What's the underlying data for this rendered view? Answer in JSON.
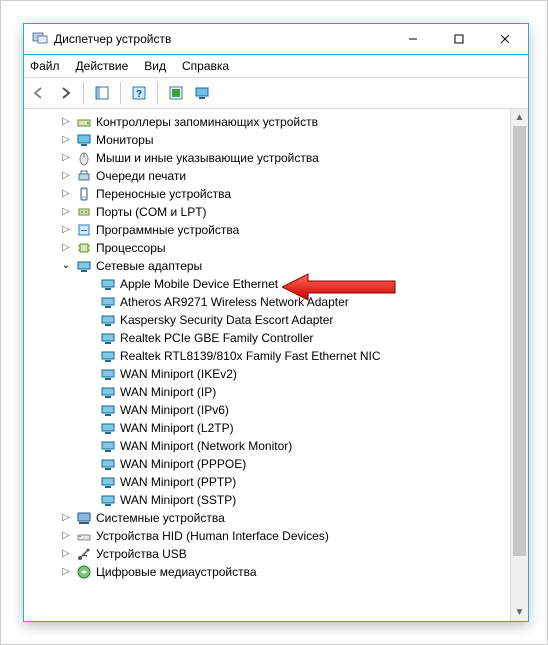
{
  "window": {
    "title": "Диспетчер устройств"
  },
  "menu": {
    "file": "Файл",
    "action": "Действие",
    "view": "Вид",
    "help": "Справка"
  },
  "categories": {
    "storage_ctrl": "Контроллеры запоминающих устройств",
    "monitors": "Мониторы",
    "mice": "Мыши и иные указывающие устройства",
    "print_queues": "Очереди печати",
    "portable": "Переносные устройства",
    "ports": "Порты (COM и LPT)",
    "software_dev": "Программные устройства",
    "processors": "Процессоры",
    "net_adapters": "Сетевые адаптеры",
    "system_dev": "Системные устройства",
    "hid": "Устройства HID (Human Interface Devices)",
    "usb": "Устройства USB",
    "digital_media": "Цифровые медиаустройства"
  },
  "net_children": [
    "Apple Mobile Device Ethernet",
    "Atheros AR9271 Wireless Network Adapter",
    "Kaspersky Security Data Escort Adapter",
    "Realtek PCIe GBE Family Controller",
    "Realtek RTL8139/810x Family Fast Ethernet NIC",
    "WAN Miniport (IKEv2)",
    "WAN Miniport (IP)",
    "WAN Miniport (IPv6)",
    "WAN Miniport (L2TP)",
    "WAN Miniport (Network Monitor)",
    "WAN Miniport (PPPOE)",
    "WAN Miniport (PPTP)",
    "WAN Miniport (SSTP)"
  ]
}
